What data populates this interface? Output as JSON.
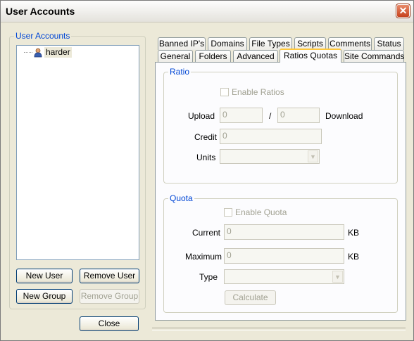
{
  "window": {
    "title": "User Accounts"
  },
  "user_accounts": {
    "legend": "User Accounts",
    "users": [
      {
        "name": "harder"
      }
    ],
    "buttons": {
      "new_user": "New User",
      "remove_user": "Remove User",
      "new_group": "New Group",
      "remove_group": "Remove Group"
    }
  },
  "close_button": "Close",
  "tabs": {
    "row1": [
      "Banned IP's",
      "Domains",
      "File Types",
      "Scripts",
      "Comments",
      "Status"
    ],
    "row2": [
      "General",
      "Folders",
      "Advanced",
      "Ratios Quotas",
      "Site Commands"
    ],
    "active": "Ratios Quotas"
  },
  "ratio": {
    "legend": "Ratio",
    "enable_label": "Enable Ratios",
    "enabled": false,
    "upload_label": "Upload",
    "upload_value": "0",
    "separator": "/",
    "download_value": "0",
    "download_label": "Download",
    "credit_label": "Credit",
    "credit_value": "0",
    "units_label": "Units",
    "units_value": ""
  },
  "quota": {
    "legend": "Quota",
    "enable_label": "Enable Quota",
    "enabled": false,
    "current_label": "Current",
    "current_value": "0",
    "current_unit": "KB",
    "maximum_label": "Maximum",
    "maximum_value": "0",
    "maximum_unit": "KB",
    "type_label": "Type",
    "type_value": "",
    "calculate_label": "Calculate"
  }
}
